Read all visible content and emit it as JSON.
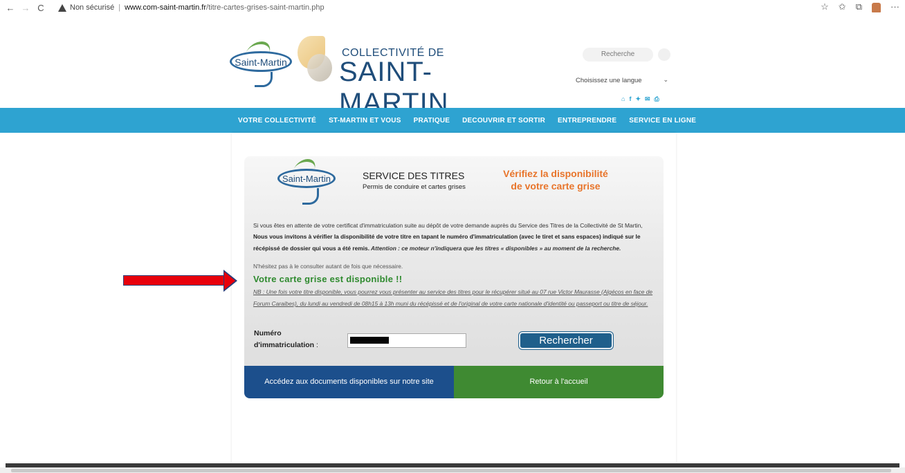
{
  "browser": {
    "back": "←",
    "forward": "→",
    "reload": "C",
    "security_label": "Non sécurisé",
    "url_domain": "www.com-saint-martin.fr",
    "url_path": "/titre-cartes-grises-saint-martin.php",
    "more": "···"
  },
  "header": {
    "logo_text": "Saint-Martin",
    "collectivite_de": "COLLECTIVITÉ DE",
    "saint_martin": "SAINT-MARTIN",
    "search_placeholder": "Recherche",
    "language_select": "Choisissez une langue",
    "social_icons": [
      "home-icon",
      "facebook-icon",
      "twitter-icon",
      "mail-icon",
      "print-icon"
    ]
  },
  "nav": {
    "items": [
      "VOTRE COLLECTIVITÉ",
      "ST-MARTIN ET VOUS",
      "PRATIQUE",
      "DECOUVRIR ET SORTIR",
      "ENTREPRENDRE",
      "SERVICE EN LIGNE"
    ]
  },
  "card": {
    "logo_text": "Saint-Martin",
    "service_title": "SERVICE DES TITRES",
    "service_subtitle": "Permis de conduire et cartes grises",
    "verify_line1": "Vérifiez la disponibilité",
    "verify_line2": "de votre carte grise",
    "intro_1": "Si vous êtes en attente de votre certificat d'immatriculation suite au dépôt de votre demande auprès du Service des Titres de la Collectivité de St Martin, ",
    "intro_bold": "Nous vous invitons à vérifier la disponibilité de votre titre en tapant le numéro d'immatriculation (avec le tiret et sans espaces) indiqué sur le récépissé de dossier qui vous a été remis.",
    "intro_italic": " Attention : ce moteur n'indiquera que les titres « disponibles » au moment de la recherche.",
    "hesitez": "N'hésitez pas à le consulter autant de fois que nécessaire.",
    "result": "Votre carte grise est disponible !!",
    "nb": "NB : Une fois votre titre disponible, vous pourrez vous présenter au service des titres pour le récupérer situé au 07 rue Victor Maurasse (Algécos en face de Forum Caraibes), du lundi au vendredi de 08h15 à 13h muni du récépissé et de l'original de votre carte nationale d'identité ou passeport ou titre de séjour.",
    "num_label_1": "Numéro",
    "num_label_2": "d'immatriculation",
    "num_colon": ":",
    "search_button": "Rechercher",
    "docs_button": "Accédez aux documents disponibles sur notre site",
    "home_button": "Retour à l'accueil"
  },
  "colors": {
    "nav_blue": "#2ea3d1",
    "result_green": "#2e8a2e",
    "verify_orange": "#e8742a",
    "docs_blue": "#1c4f8c",
    "home_green": "#3f8a32",
    "arrow_red": "#e8000b"
  }
}
